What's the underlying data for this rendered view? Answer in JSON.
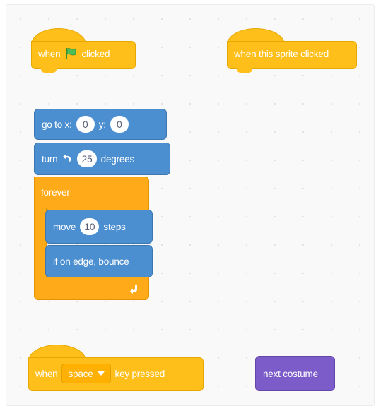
{
  "blocks": {
    "flag_hat": {
      "when": "when",
      "clicked": "clicked",
      "icon": "green-flag-icon"
    },
    "sprite_hat": {
      "label": "when this sprite clicked"
    },
    "goto": {
      "prefix": "go to x:",
      "x": "0",
      "ylabel": "y:",
      "y": "0"
    },
    "turn": {
      "prefix": "turn",
      "icon": "rotate-left-icon",
      "degrees": "25",
      "suffix": "degrees"
    },
    "forever": {
      "label": "forever",
      "icon": "loop-arrow-icon"
    },
    "move": {
      "prefix": "move",
      "steps": "10",
      "suffix": "steps"
    },
    "bounce": {
      "label": "if on edge, bounce"
    },
    "key_hat": {
      "when": "when",
      "key": "space",
      "suffix": "key pressed"
    },
    "costume": {
      "label": "next costume"
    }
  },
  "colors": {
    "events": "#ffbf1a",
    "control": "#ffab19",
    "motion": "#4c8fd0",
    "looks": "#7c5cc8"
  }
}
